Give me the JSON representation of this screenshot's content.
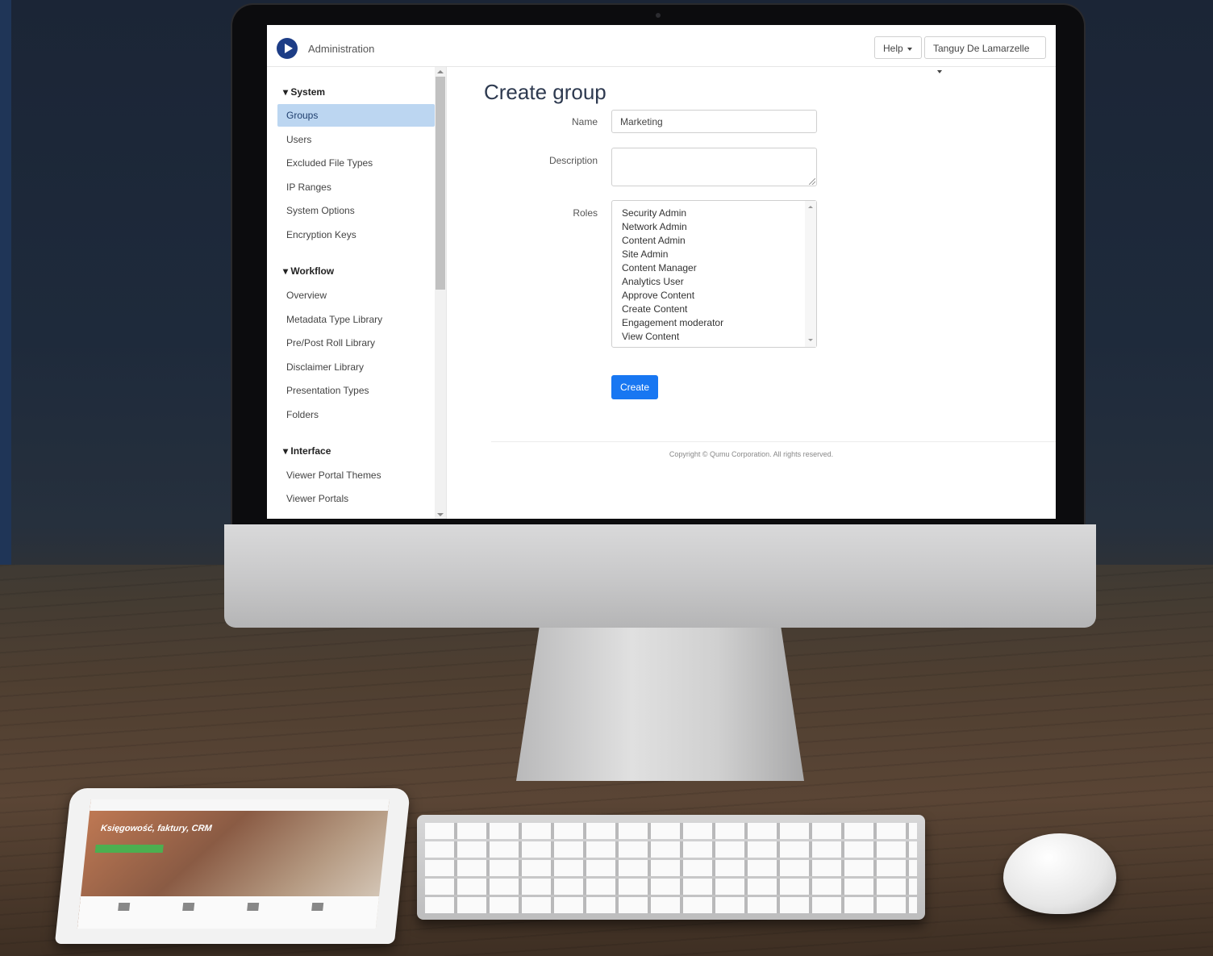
{
  "app": {
    "title": "Administration"
  },
  "header": {
    "help_label": "Help",
    "user_label": "Tanguy De Lamarzelle"
  },
  "sidebar": {
    "sections": [
      {
        "title": "▾ System",
        "items": [
          "Groups",
          "Users",
          "Excluded File Types",
          "IP Ranges",
          "System Options",
          "Encryption Keys"
        ]
      },
      {
        "title": "▾ Workflow",
        "items": [
          "Overview",
          "Metadata Type Library",
          "Pre/Post Roll Library",
          "Disclaimer Library",
          "Presentation Types",
          "Folders"
        ]
      },
      {
        "title": "▾ Interface",
        "items": [
          "Viewer Portal Themes",
          "Viewer Portals"
        ]
      }
    ],
    "active_item": "Groups"
  },
  "form": {
    "heading": "Create group",
    "name_label": "Name",
    "name_value": "Marketing",
    "description_label": "Description",
    "description_value": "",
    "roles_label": "Roles",
    "roles": [
      "Security Admin",
      "Network Admin",
      "Content Admin",
      "Site Admin",
      "Content Manager",
      "Analytics User",
      "Approve Content",
      "Create Content",
      "Engagement moderator",
      "View Content"
    ],
    "create_label": "Create"
  },
  "footer": {
    "copyright": "Copyright © Qumu Corporation. All rights reserved."
  },
  "tablet": {
    "headline": "Księgowość, faktury, CRM"
  },
  "colors": {
    "accent": "#1877f2",
    "active_nav_bg": "#bcd6f1",
    "logo": "#1d3d86"
  }
}
